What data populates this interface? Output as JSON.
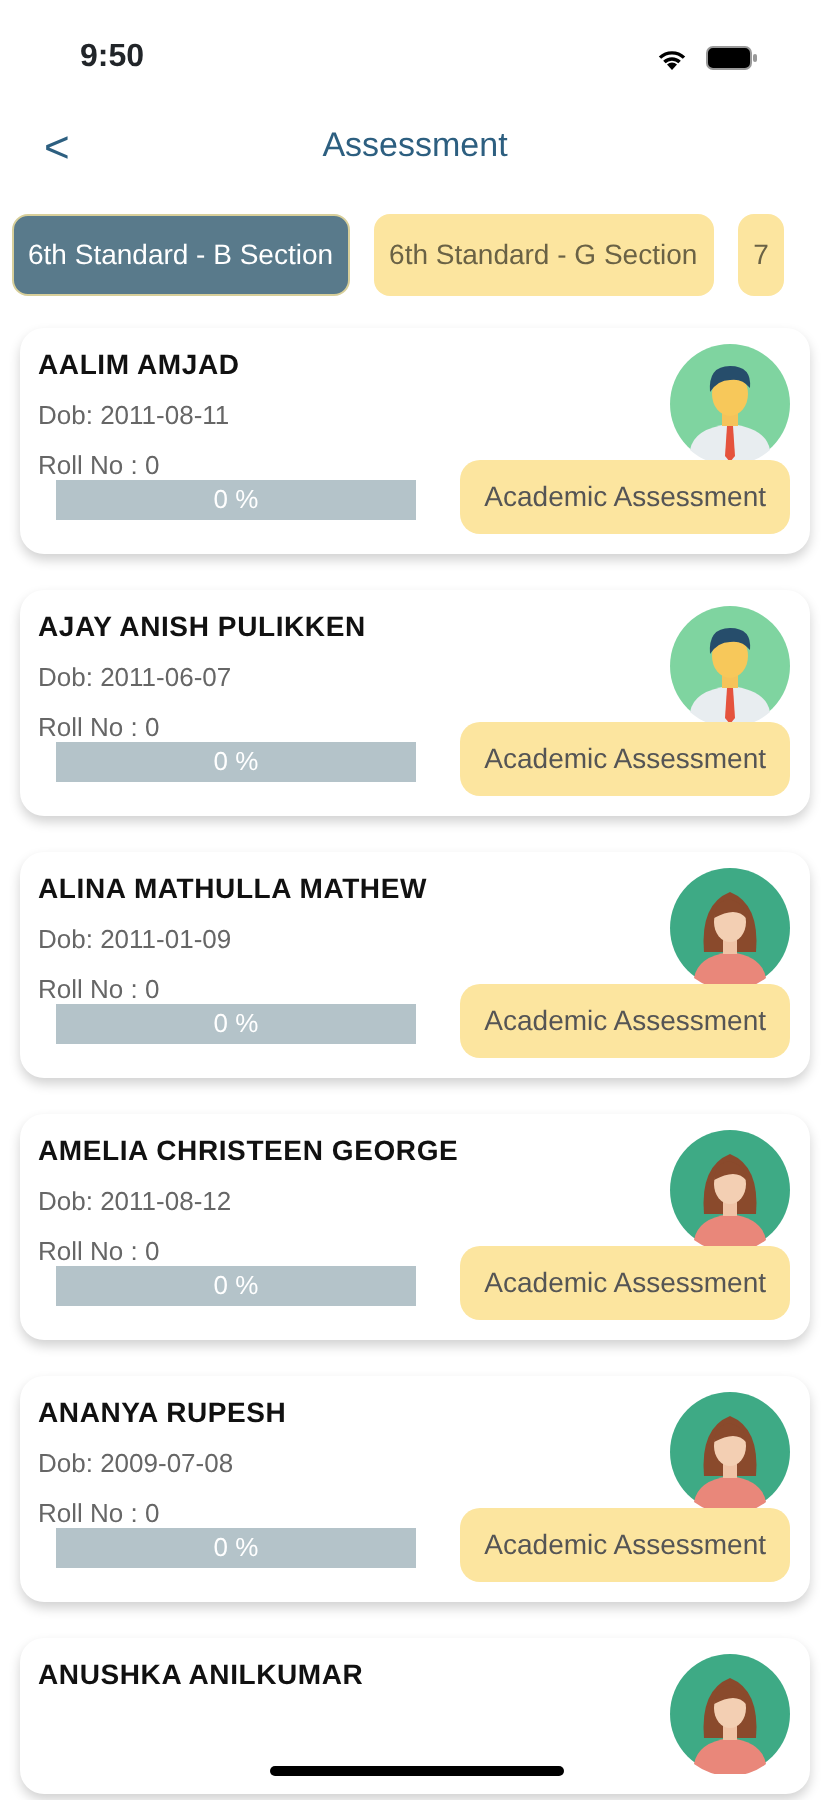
{
  "status_bar": {
    "time": "9:50"
  },
  "header": {
    "back": "<",
    "title": "Assessment"
  },
  "tabs": [
    {
      "label": "6th Standard - B Section",
      "selected": true
    },
    {
      "label": "6th Standard - G Section",
      "selected": false
    },
    {
      "label": "7",
      "selected": false
    }
  ],
  "students": [
    {
      "name": "AALIM AMJAD",
      "dob": "Dob: 2011-08-11",
      "roll": "Roll No : 0",
      "kind": "male",
      "level": 0,
      "progress_text": "0 %",
      "button": "Academic Assessment"
    },
    {
      "name": "AJAY ANISH PULIKKEN",
      "dob": "Dob: 2011-06-07",
      "roll": "Roll No : 0",
      "kind": "male",
      "level": 0,
      "progress_text": "0 %",
      "button": "Academic Assessment"
    },
    {
      "name": "ALINA MATHULLA MATHEW",
      "dob": "Dob: 2011-01-09",
      "roll": "Roll No : 0",
      "kind": "female",
      "level": 0,
      "progress_text": "0 %",
      "button": "Academic Assessment"
    },
    {
      "name": "AMELIA CHRISTEEN GEORGE",
      "dob": "Dob: 2011-08-12",
      "roll": "Roll No : 0",
      "kind": "female",
      "level": 0,
      "progress_text": "0 %",
      "button": "Academic Assessment"
    },
    {
      "name": "ANANYA RUPESH",
      "dob": "Dob: 2009-07-08",
      "roll": "Roll No : 0",
      "kind": "female",
      "level": 0,
      "progress_text": "0 %",
      "button": "Academic Assessment"
    },
    {
      "name": "ANUSHKA ANILKUMAR",
      "kind": "female"
    }
  ]
}
